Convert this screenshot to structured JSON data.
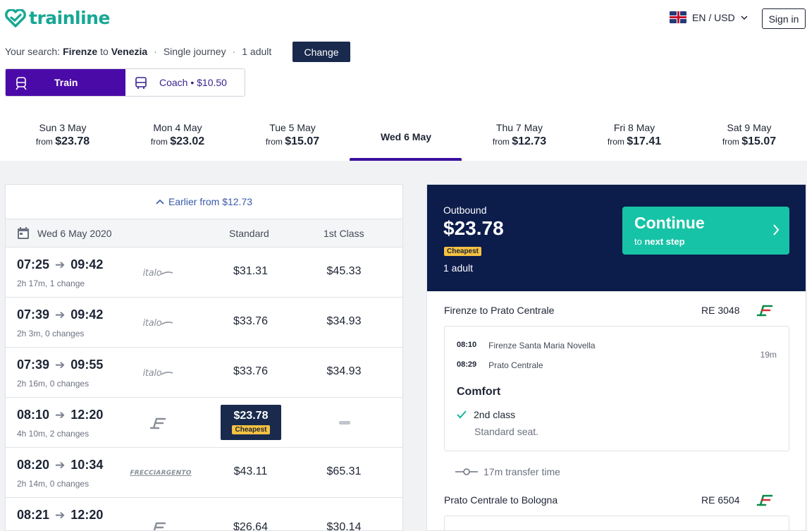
{
  "header": {
    "logo_text": "trainline",
    "locale": "EN / USD",
    "signin": "Sign in"
  },
  "search": {
    "prefix": "Your search:",
    "origin": "Firenze",
    "to": "to",
    "destination": "Venezia",
    "journey_type": "Single journey",
    "passengers": "1 adult",
    "change_label": "Change"
  },
  "modes": {
    "train": "Train",
    "coach": "Coach • $10.50"
  },
  "dates": [
    {
      "day": "Sun 3 May",
      "from": "from",
      "price": "$23.78"
    },
    {
      "day": "Mon 4 May",
      "from": "from",
      "price": "$23.02"
    },
    {
      "day": "Tue 5 May",
      "from": "from",
      "price": "$15.07"
    },
    {
      "day": "Wed 6 May"
    },
    {
      "day": "Thu 7 May",
      "from": "from",
      "price": "$12.73"
    },
    {
      "day": "Fri 8 May",
      "from": "from",
      "price": "$17.41"
    },
    {
      "day": "Sat 9 May",
      "from": "from",
      "price": "$15.07"
    }
  ],
  "results": {
    "earlier": "Earlier from $12.73",
    "date": "Wed 6 May 2020",
    "col_standard": "Standard",
    "col_first": "1st Class",
    "rows": [
      {
        "dep": "07:25",
        "arr": "09:42",
        "info": "2h 17m, 1 change",
        "carrier": "italo",
        "std": "$31.31",
        "first": "$45.33"
      },
      {
        "dep": "07:39",
        "arr": "09:42",
        "info": "2h 3m, 0 changes",
        "carrier": "italo",
        "std": "$33.76",
        "first": "$34.93"
      },
      {
        "dep": "07:39",
        "arr": "09:55",
        "info": "2h 16m, 0 changes",
        "carrier": "italo",
        "std": "$33.76",
        "first": "$34.93"
      },
      {
        "dep": "08:10",
        "arr": "12:20",
        "info": "4h 10m, 2 changes",
        "carrier": "trenitalia",
        "std": "$23.78",
        "first": "",
        "cheapest": "Cheapest"
      },
      {
        "dep": "08:20",
        "arr": "10:34",
        "info": "2h 14m, 0 changes",
        "carrier": "FRECCIARGENTO",
        "std": "$43.11",
        "first": "$65.31"
      },
      {
        "dep": "08:21",
        "arr": "12:20",
        "info": "",
        "carrier": "trenitalia",
        "std": "$26.64",
        "first": "$30.14"
      }
    ]
  },
  "summary": {
    "label": "Outbound",
    "price": "$23.78",
    "tag": "Cheapest",
    "passengers": "1 adult",
    "continue_title": "Continue",
    "continue_sub_pre": "to",
    "continue_sub_bold": "next step",
    "leg1": {
      "title": "Firenze to Prato Centrale",
      "code": "RE 3048",
      "dep_time": "08:10",
      "dep_station": "Firenze Santa Maria Novella",
      "arr_time": "08:29",
      "arr_station": "Prato Centrale",
      "duration": "19m",
      "comfort": "Comfort",
      "class": "2nd class",
      "seat": "Standard seat."
    },
    "transfer": "17m transfer time",
    "leg2": {
      "title": "Prato Centrale to Bologna",
      "code": "RE 6504"
    }
  },
  "colors": {
    "brand": "#17a894",
    "train_tab": "#4a0aa8",
    "navy": "#0c1c4b",
    "continue": "#17c3a6",
    "cheapest": "#f5c242"
  }
}
